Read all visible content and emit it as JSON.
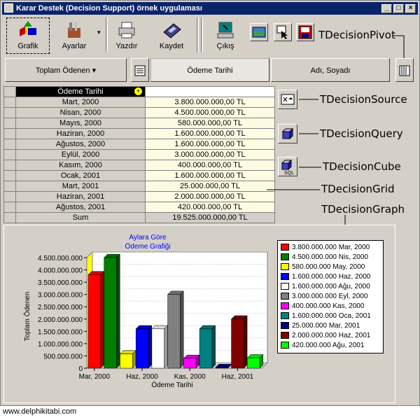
{
  "window": {
    "title": "Karar Destek (Decision Support) örnek uygulaması",
    "min": "_",
    "max": "□",
    "close": "×"
  },
  "toolbar": {
    "grafik": "Grafik",
    "ayarlar": "Ayarlar",
    "yazdir": "Yazdır",
    "kaydet": "Kaydet",
    "cikis": "Çıkış"
  },
  "pivot": {
    "summary": "Toplam Ödenen ▾",
    "col1": "Ödeme Tarihi",
    "col2": "Adı, Soyadı"
  },
  "labels": {
    "pivot": "TDecisionPivot",
    "source": "TDecisionSource",
    "query": "TDecisionQuery",
    "cube": "TDecisionCube",
    "grid": "TDecisionGrid",
    "graph": "TDecisionGraph"
  },
  "grid": {
    "header": "Ödeme Tarihi",
    "rows": [
      {
        "date": "Mart, 2000",
        "value": "3.800.000.000,00 TL"
      },
      {
        "date": "Nisan, 2000",
        "value": "4.500.000.000,00 TL"
      },
      {
        "date": "Mayıs, 2000",
        "value": "580.000.000,00 TL"
      },
      {
        "date": "Haziran, 2000",
        "value": "1.600.000.000,00 TL"
      },
      {
        "date": "Ağustos, 2000",
        "value": "1.600.000.000,00 TL"
      },
      {
        "date": "Eylül, 2000",
        "value": "3.000.000.000,00 TL"
      },
      {
        "date": "Kasım, 2000",
        "value": "400.000.000,00 TL"
      },
      {
        "date": "Ocak, 2001",
        "value": "1.600.000.000,00 TL"
      },
      {
        "date": "Mart, 2001",
        "value": "25.000.000,00 TL"
      },
      {
        "date": "Haziran, 2001",
        "value": "2.000.000.000,00 TL"
      },
      {
        "date": "Ağustos, 2001",
        "value": "420.000.000,00 TL"
      }
    ],
    "sum_label": "Sum",
    "sum_value": "19.525.000.000,00 TL"
  },
  "chart_data": {
    "type": "bar",
    "title": "Aylara Göre\nÖdeme Grafiği",
    "xlabel": "Ödeme Tarihi",
    "ylabel": "Toplam Ödenen",
    "ylim": [
      0,
      4500000000
    ],
    "yticks": [
      "0",
      "500.000.000",
      "1.000.000.000",
      "1.500.000.000",
      "2.000.000.000",
      "2.500.000.000",
      "3.000.000.000",
      "3.500.000.000",
      "4.000.000.000",
      "4.500.000.000"
    ],
    "xticks": [
      "Mar, 2000",
      "Haz, 2000",
      "Kas, 2000",
      "Haz, 2001"
    ],
    "series": [
      {
        "name": "3.800.000.000 Mar, 2000",
        "value": 3800000000,
        "color": "#ff0000"
      },
      {
        "name": "4.500.000.000 Nis, 2000",
        "value": 4500000000,
        "color": "#008000"
      },
      {
        "name": "580.000.000 May, 2000",
        "value": 580000000,
        "color": "#ffff00"
      },
      {
        "name": "1.600.000.000 Haz, 2000",
        "value": 1600000000,
        "color": "#0000ff"
      },
      {
        "name": "1.600.000.000 Ağu, 2000",
        "value": 1600000000,
        "color": "#ffffff"
      },
      {
        "name": "3.000.000.000 Eyl, 2000",
        "value": 3000000000,
        "color": "#808080"
      },
      {
        "name": "400.000.000 Kas, 2000",
        "value": 400000000,
        "color": "#ff00ff"
      },
      {
        "name": "1.600.000.000 Oca, 2001",
        "value": 1600000000,
        "color": "#008080"
      },
      {
        "name": "25.000.000 Mar, 2001",
        "value": 25000000,
        "color": "#000080"
      },
      {
        "name": "2.000.000.000 Haz, 2001",
        "value": 2000000000,
        "color": "#800000"
      },
      {
        "name": "420.000.000 Ağu, 2001",
        "value": 420000000,
        "color": "#00ff00"
      }
    ]
  },
  "footer": "www.delphikitabi.com"
}
